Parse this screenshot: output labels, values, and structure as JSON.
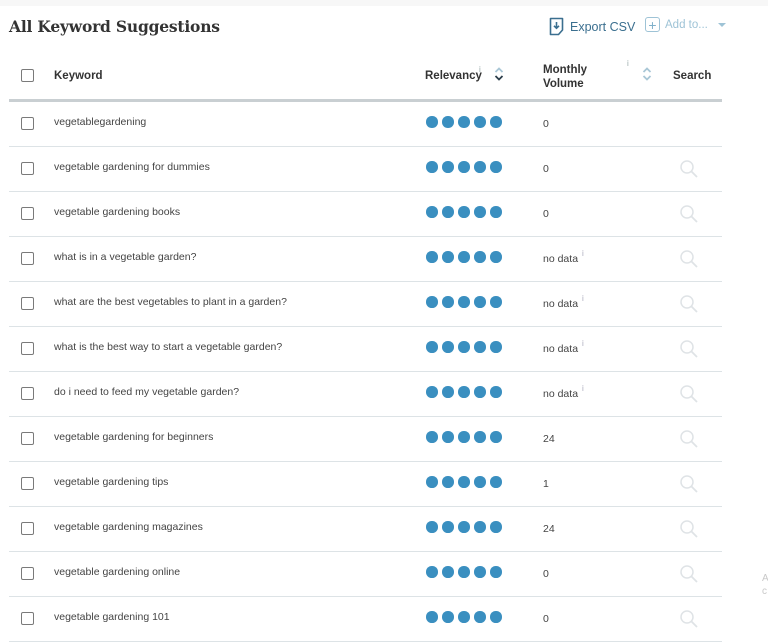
{
  "header": {
    "title": "All Keyword Suggestions",
    "export_label": "Export CSV",
    "add_to_label": "Add to..."
  },
  "columns": {
    "keyword": "Keyword",
    "relevancy": "Relevancy",
    "relevancy_info": "i",
    "monthly_volume_line1": "Monthly",
    "monthly_volume_line2": "Volume",
    "monthly_volume_info": "i",
    "search": "Search"
  },
  "sort": {
    "active_column": "relevancy",
    "direction": "descending"
  },
  "colors": {
    "accent": "#3a8fc0",
    "link": "#3b6f8f",
    "muted": "#9ec3d6"
  },
  "rows": [
    {
      "keyword": "vegetablegardening",
      "relevancy": 5,
      "volume": "0",
      "no_data": false,
      "search_icon": false
    },
    {
      "keyword": "vegetable gardening for dummies",
      "relevancy": 5,
      "volume": "0",
      "no_data": false,
      "search_icon": true
    },
    {
      "keyword": "vegetable gardening books",
      "relevancy": 5,
      "volume": "0",
      "no_data": false,
      "search_icon": true
    },
    {
      "keyword": "what is in a vegetable garden?",
      "relevancy": 5,
      "volume": "no data",
      "no_data": true,
      "search_icon": true
    },
    {
      "keyword": "what are the best vegetables to plant in a garden?",
      "relevancy": 5,
      "volume": "no data",
      "no_data": true,
      "search_icon": true
    },
    {
      "keyword": "what is the best way to start a vegetable garden?",
      "relevancy": 5,
      "volume": "no data",
      "no_data": true,
      "search_icon": true
    },
    {
      "keyword": "do i need to feed my vegetable garden?",
      "relevancy": 5,
      "volume": "no data",
      "no_data": true,
      "search_icon": true
    },
    {
      "keyword": "vegetable gardening for beginners",
      "relevancy": 5,
      "volume": "24",
      "no_data": false,
      "search_icon": true
    },
    {
      "keyword": "vegetable gardening tips",
      "relevancy": 5,
      "volume": "1",
      "no_data": false,
      "search_icon": true
    },
    {
      "keyword": "vegetable gardening magazines",
      "relevancy": 5,
      "volume": "24",
      "no_data": false,
      "search_icon": true
    },
    {
      "keyword": "vegetable gardening online",
      "relevancy": 5,
      "volume": "0",
      "no_data": false,
      "search_icon": true
    },
    {
      "keyword": "vegetable gardening 101",
      "relevancy": 5,
      "volume": "0",
      "no_data": false,
      "search_icon": true
    }
  ],
  "edge_text": [
    "A",
    "c"
  ]
}
